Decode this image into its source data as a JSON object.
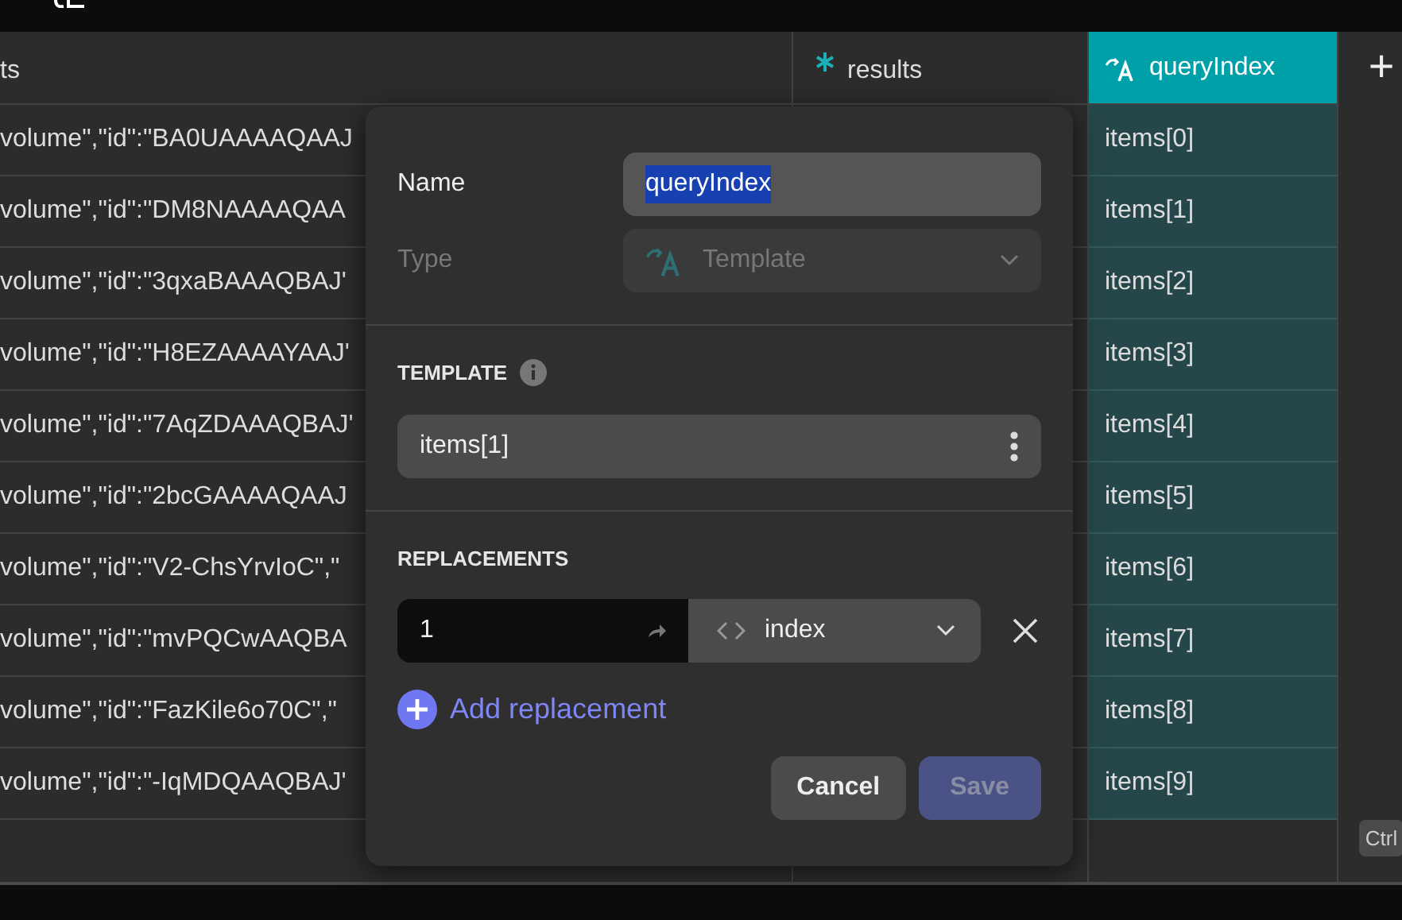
{
  "table": {
    "columns": [
      {
        "label": "ts",
        "kind": "text",
        "selected": false
      },
      {
        "label": "results",
        "kind": "script",
        "selected": false
      },
      {
        "label": "queryIndex",
        "kind": "template",
        "selected": true
      }
    ],
    "rows": [
      {
        "column_1": "volume\",\"id\":\"BA0UAAAAQAAJ",
        "query_index": "items[0]"
      },
      {
        "column_1": "volume\",\"id\":\"DM8NAAAAQAA",
        "query_index": "items[1]"
      },
      {
        "column_1": "volume\",\"id\":\"3qxaBAAAQBAJ'",
        "query_index": "items[2]"
      },
      {
        "column_1": "volume\",\"id\":\"H8EZAAAAYAAJ'",
        "query_index": "items[3]"
      },
      {
        "column_1": "volume\",\"id\":\"7AqZDAAAQBAJ'",
        "query_index": "items[4]"
      },
      {
        "column_1": "volume\",\"id\":\"2bcGAAAAQAAJ",
        "query_index": "items[5]"
      },
      {
        "column_1": "volume\",\"id\":\"V2-ChsYrvIoC\",\"",
        "query_index": "items[6]"
      },
      {
        "column_1": "volume\",\"id\":\"mvPQCwAAQBA",
        "query_index": "items[7]"
      },
      {
        "column_1": "volume\",\"id\":\"FazKile6o70C\",\"",
        "query_index": "items[8]"
      },
      {
        "column_1": "volume\",\"id\":\"-IqMDQAAQBAJ'",
        "query_index": "items[9]"
      }
    ],
    "add_column": "+",
    "shortcut_hint": "Ctrl"
  },
  "dialog": {
    "name": {
      "label": "Name",
      "value": "queryIndex",
      "text_selected": true
    },
    "type": {
      "label": "Type",
      "value": "Template",
      "disabled": true
    },
    "template": {
      "heading": "TEMPLATE",
      "value": "items[1]"
    },
    "replacements": {
      "heading": "REPLACEMENTS",
      "items": [
        {
          "value": "1",
          "type": "index"
        }
      ],
      "add_label": "Add replacement"
    },
    "buttons": [
      {
        "label": "Cancel",
        "kind": "secondary",
        "disabled": false
      },
      {
        "label": "Save",
        "kind": "primary",
        "disabled": true
      }
    ]
  }
}
